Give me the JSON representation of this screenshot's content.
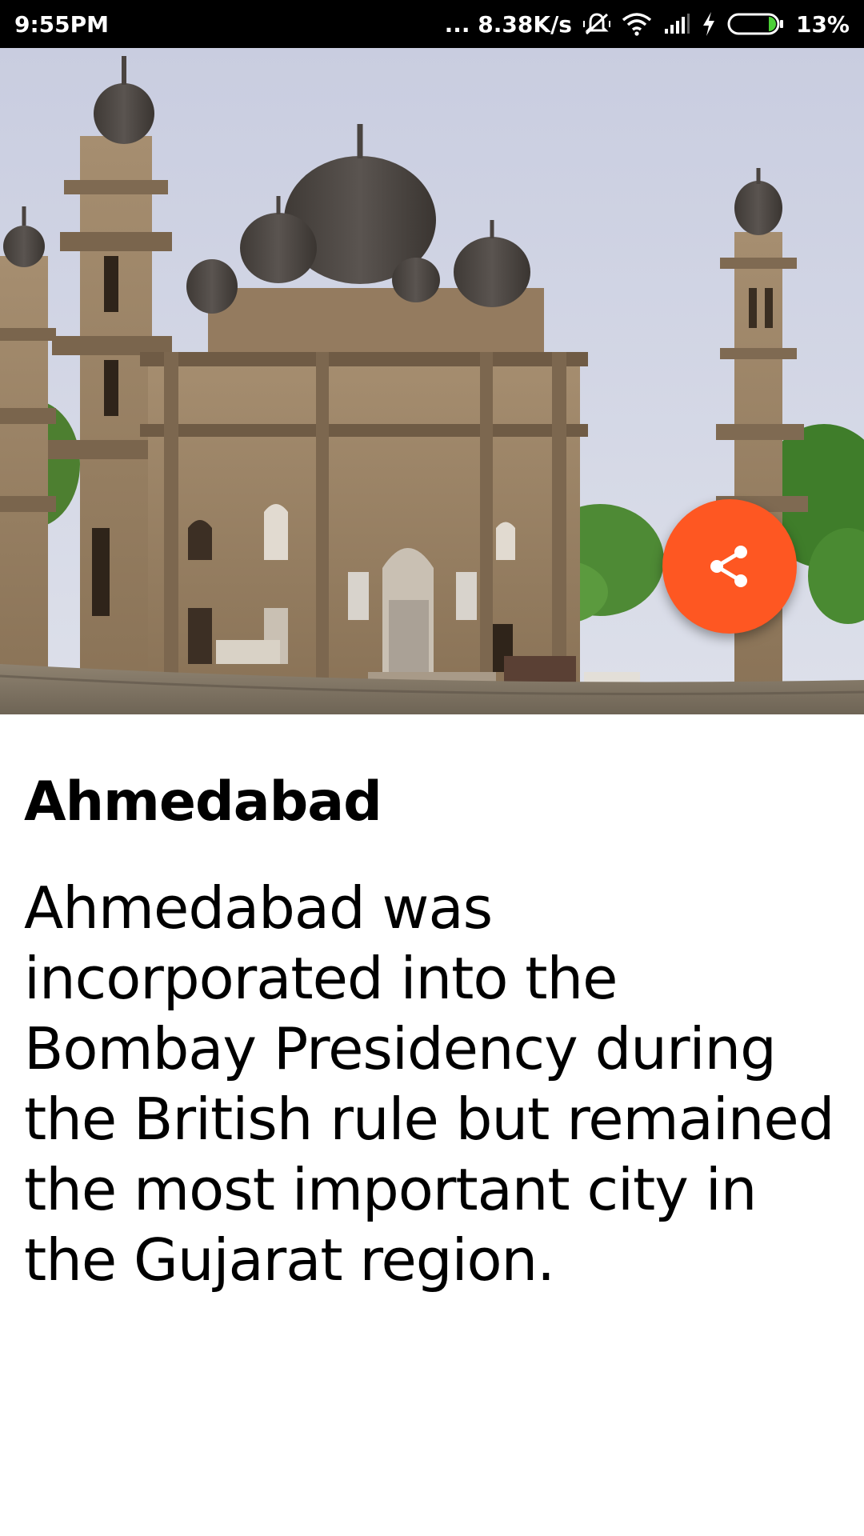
{
  "status_bar": {
    "time": "9:55PM",
    "network_speed": "... 8.38K/s",
    "battery_percent": "13%",
    "icons": [
      "mute-vibrate-icon",
      "wifi-icon",
      "signal-icon",
      "charging-icon",
      "battery-icon"
    ]
  },
  "hero": {
    "image_subject": "mosque-photo",
    "sky_color": "#cfd4e3",
    "stone_color": "#9c8467"
  },
  "fab": {
    "icon": "share-icon",
    "color": "#fe5722"
  },
  "detail": {
    "title": "Ahmedabad",
    "description": "Ahmedabad was incorporated into the Bombay Presidency during the British rule but remained the most important city in the Gujarat region."
  }
}
